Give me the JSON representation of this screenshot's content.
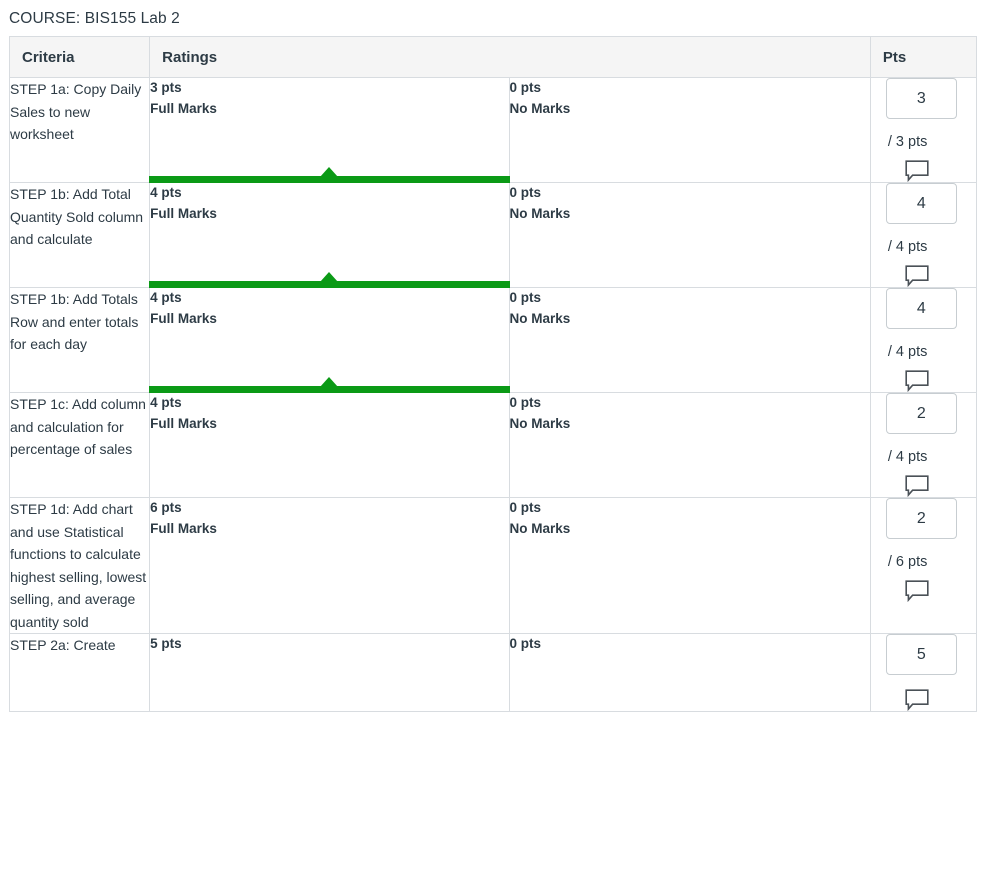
{
  "course_title": "COURSE: BIS155 Lab 2",
  "table": {
    "headers": {
      "criteria": "Criteria",
      "ratings": "Ratings",
      "pts": "Pts"
    },
    "comment_icon": "comment-bubble-icon",
    "selected_color": "#0b9a16",
    "rows": [
      {
        "criterion": "STEP 1a: Copy Daily Sales to new worksheet",
        "ratings": [
          {
            "pts": "3 pts",
            "desc": "Full Marks",
            "selected": true
          },
          {
            "pts": "0 pts",
            "desc": "No Marks",
            "selected": false
          }
        ],
        "score": "3",
        "out_of": "/ 3 pts"
      },
      {
        "criterion": "STEP 1b: Add Total Quantity Sold column and calculate",
        "ratings": [
          {
            "pts": "4 pts",
            "desc": "Full Marks",
            "selected": true
          },
          {
            "pts": "0 pts",
            "desc": "No Marks",
            "selected": false
          }
        ],
        "score": "4",
        "out_of": "/ 4 pts"
      },
      {
        "criterion": "STEP 1b: Add Totals Row and enter totals for each day",
        "ratings": [
          {
            "pts": "4 pts",
            "desc": "Full Marks",
            "selected": true
          },
          {
            "pts": "0 pts",
            "desc": "No Marks",
            "selected": false
          }
        ],
        "score": "4",
        "out_of": "/ 4 pts"
      },
      {
        "criterion": "STEP 1c: Add column and calculation for percentage of sales",
        "ratings": [
          {
            "pts": "4 pts",
            "desc": "Full Marks",
            "selected": false
          },
          {
            "pts": "0 pts",
            "desc": "No Marks",
            "selected": false
          }
        ],
        "score": "2",
        "out_of": "/ 4 pts"
      },
      {
        "criterion": "STEP 1d: Add chart and use Statistical functions to calculate highest selling, lowest selling, and average quantity sold",
        "ratings": [
          {
            "pts": "6 pts",
            "desc": "Full Marks",
            "selected": false
          },
          {
            "pts": "0 pts",
            "desc": "No Marks",
            "selected": false
          }
        ],
        "score": "2",
        "out_of": "/ 6 pts"
      },
      {
        "criterion": "STEP 2a: Create",
        "ratings": [
          {
            "pts": "5 pts",
            "desc": "",
            "selected": false
          },
          {
            "pts": "0 pts",
            "desc": "",
            "selected": false
          }
        ],
        "score": "5",
        "out_of": ""
      }
    ]
  }
}
